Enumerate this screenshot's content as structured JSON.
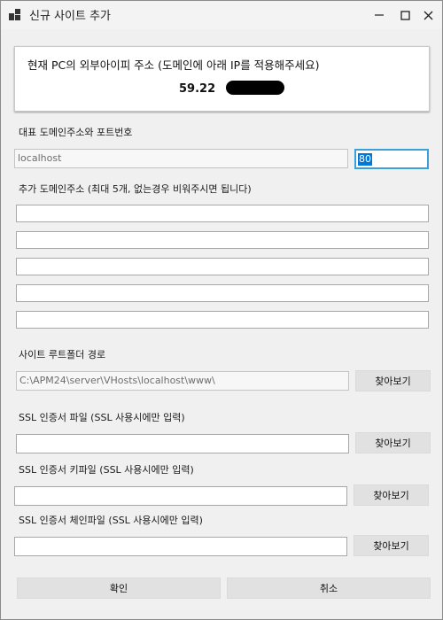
{
  "window": {
    "title": "신규 사이트 추가"
  },
  "ip_panel": {
    "title": "현재 PC의 외부아이피 주소 (도메인에 아래 IP를 적용해주세요)",
    "ip_value": "59.22"
  },
  "main_domain": {
    "label": "대표 도메인주소와 포트번호",
    "domain_value": "localhost",
    "port_value": "80"
  },
  "extra_domains": {
    "label": "추가 도메인주소 (최대 5개, 없는경우 비워주시면 됩니다)",
    "values": [
      "",
      "",
      "",
      "",
      ""
    ]
  },
  "root_folder": {
    "label": "사이트 루트폴더 경로",
    "value": "C:\\APM24\\server\\VHosts\\localhost\\www\\",
    "browse_label": "찾아보기"
  },
  "ssl_cert": {
    "label": "SSL 인증서 파일 (SSL 사용시에만 입력)",
    "value": "",
    "browse_label": "찾아보기"
  },
  "ssl_key": {
    "label": "SSL 인증서 키파일 (SSL 사용시에만 입력)",
    "value": "",
    "browse_label": "찾아보기"
  },
  "ssl_chain": {
    "label": "SSL 인증서 체인파일 (SSL 사용시에만 입력)",
    "value": "",
    "browse_label": "찾아보기"
  },
  "footer": {
    "ok_label": "확인",
    "cancel_label": "취소"
  }
}
